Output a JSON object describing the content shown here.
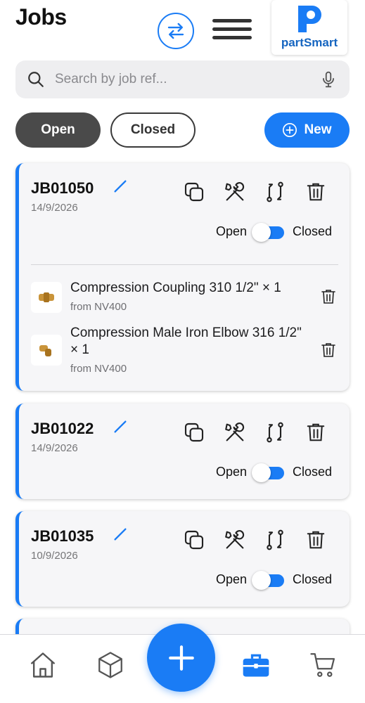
{
  "header": {
    "title": "Jobs",
    "logo_text": "partSmart"
  },
  "search": {
    "placeholder": "Search by job ref..."
  },
  "filters": {
    "open": "Open",
    "closed": "Closed",
    "new": "New"
  },
  "jobs": [
    {
      "ref": "JB01050",
      "date": "14/9/2026",
      "open_label": "Open",
      "closed_label": "Closed",
      "status": "closed",
      "parts": [
        {
          "name": "Compression Coupling 310 1/2\" × 1",
          "from": "from NV400"
        },
        {
          "name": "Compression Male Iron Elbow 316 1/2\" × 1",
          "from": "from NV400"
        }
      ]
    },
    {
      "ref": "JB01022",
      "date": "14/9/2026",
      "open_label": "Open",
      "closed_label": "Closed",
      "status": "closed",
      "parts": []
    },
    {
      "ref": "JB01035",
      "date": "10/9/2026",
      "open_label": "Open",
      "closed_label": "Closed",
      "status": "closed",
      "parts": []
    }
  ],
  "icons": {
    "swap": "swap-arrows-icon",
    "menu": "hamburger-menu-icon",
    "search": "search-icon",
    "mic": "microphone-icon",
    "edit": "pencil-icon",
    "copy": "copy-icon",
    "tools": "tools-icon",
    "transfer": "transfer-icon",
    "delete": "trash-icon",
    "home": "home-icon",
    "catalog": "box-icon",
    "add": "plus-icon",
    "jobs": "briefcase-icon",
    "cart": "cart-icon"
  },
  "colors": {
    "accent": "#1a7cf5",
    "open_pill": "#4a4a4a",
    "card_bg": "#f6f6f8",
    "logo": "#1565c0"
  }
}
